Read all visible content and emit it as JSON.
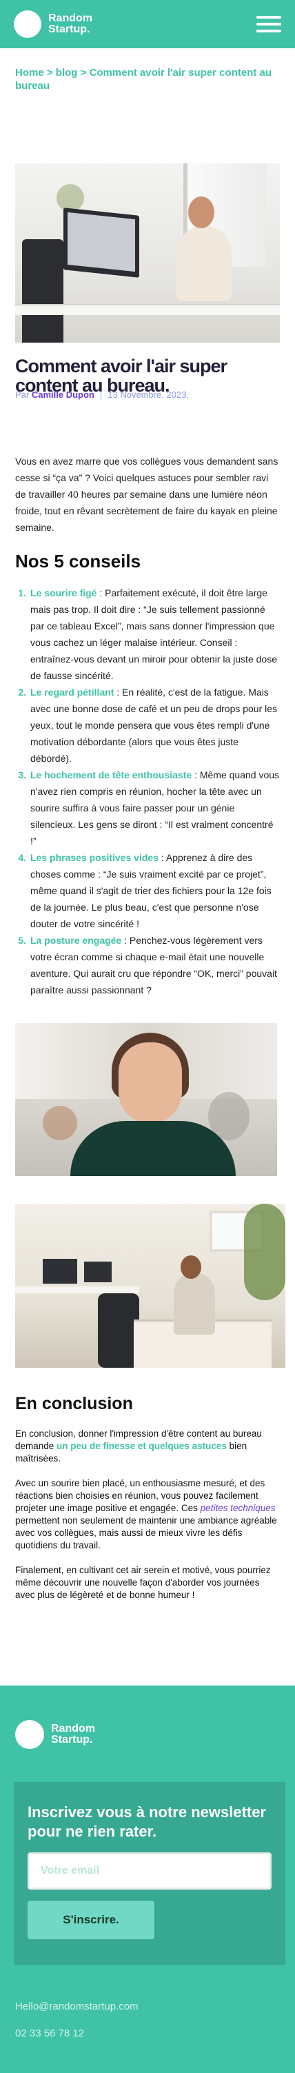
{
  "header": {
    "brand_line1": "Random",
    "brand_line2": "Startup."
  },
  "breadcrumb": {
    "home": "Home",
    "sep1": " > ",
    "blog": "blog",
    "sep2": " > ",
    "current": "Comment avoir l'air super content au bureau"
  },
  "article": {
    "title": "Comment avoir l'air super content au bureau.",
    "meta_prefix": "Par ",
    "author": "Camille Dupon",
    "meta_sep": "|",
    "date": "13 Novembre, 2023.",
    "intro": "Vous en avez marre que vos collègues vous demandent sans cesse si “ça va” ? Voici quelques astuces pour sembler ravi de travailler 40 heures par semaine dans une lumière néon froide, tout en rêvant secrètement de faire du kayak en pleine semaine.",
    "section_title": "Nos 5 conseils",
    "tips": [
      {
        "label": "Le sourire figé",
        "text": " : Parfaitement exécuté, il doit être large mais pas trop. Il doit dire : “Je suis tellement passionné par ce tableau Excel”, mais sans donner l'impression que vous cachez un léger malaise intérieur. Conseil : entraînez-vous devant un miroir pour obtenir la juste dose de fausse sincérité."
      },
      {
        "label": "Le regard pétillant",
        "text": " : En réalité, c'est de la fatigue. Mais avec une bonne dose de café et un peu de drops pour les yeux, tout le monde pensera que vous êtes rempli d'une motivation débordante (alors que vous êtes juste débordé)."
      },
      {
        "label": "Le hochement de tête enthousiaste",
        "text": " : Même quand vous n'avez rien compris en réunion, hocher la tête avec un sourire suffira à vous faire passer pour un génie silencieux. Les gens se diront : “Il est vraiment concentré !”"
      },
      {
        "label": "Les phrases positives vides",
        "text": " : Apprenez à dire des choses comme : “Je suis vraiment excité par ce projet”, même quand il s'agit de trier des fichiers pour la 12e fois de la journée. Le plus beau, c'est que personne n'ose douter de votre sincérité !"
      },
      {
        "label": "La posture engagée",
        "text": " : Penchez-vous légèrement vers votre écran comme si chaque e-mail était une nouvelle aventure. Qui aurait cru que répondre “OK, merci” pouvait paraître aussi passionnant ?"
      }
    ],
    "conclusion_title": "En conclusion",
    "conclusion_p1_a": "En conclusion, donner l'impression d'être content au bureau demande ",
    "conclusion_p1_kw": "un peu de finesse et quelques astuces",
    "conclusion_p1_b": " bien maîtrisées.",
    "conclusion_p2_a": "Avec un sourire bien placé, un enthousiasme mesuré, et des réactions bien choisies en réunion, vous pouvez facilement projeter une image positive et engagée. Ces ",
    "conclusion_p2_em": "petites techniques",
    "conclusion_p2_b": " permettent non seulement de maintenir une ambiance agréable avec vos collègues, mais aussi de mieux vivre les défis quotidiens du travail.",
    "conclusion_p3": "Finalement, en cultivant cet air serein et motivé, vous pourriez même découvrir une nouvelle façon d'aborder vos journées avec plus de légèreté et de bonne humeur !"
  },
  "footer": {
    "brand_line1": "Random",
    "brand_line2": "Startup.",
    "newsletter_title": "Inscrivez vous à notre newsletter pour ne rien rater.",
    "email_placeholder": "Votre email",
    "subscribe_label": "S'inscrire.",
    "email": "Hello@randomstartup.com",
    "phone": "02 33 56 78 12"
  },
  "colors": {
    "accent": "#3fc2a6",
    "accent_dark": "#37a891",
    "author": "#6a3bd6",
    "button": "#72d8c6"
  },
  "icons": {
    "menu": "hamburger-menu-icon",
    "logo": "logo-circle-icon"
  }
}
